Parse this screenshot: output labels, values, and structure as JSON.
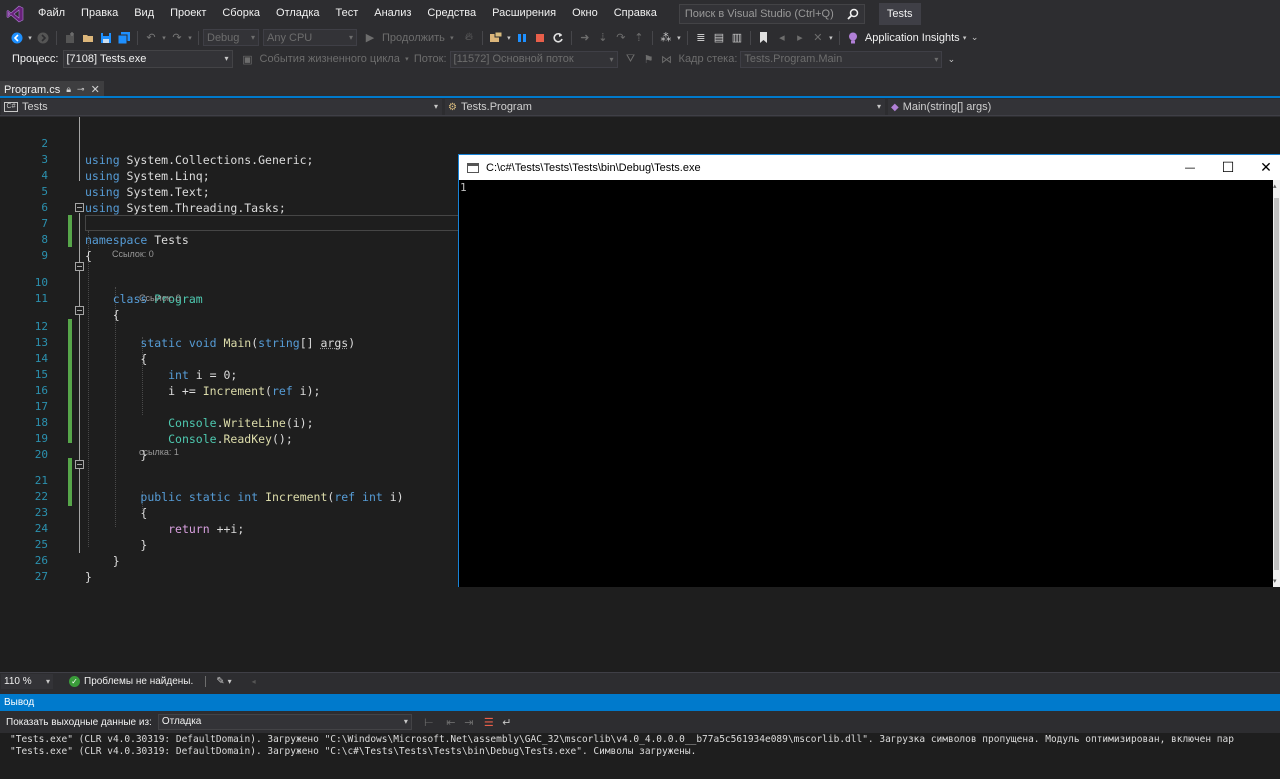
{
  "menu": {
    "items": [
      "Файл",
      "Правка",
      "Вид",
      "Проект",
      "Сборка",
      "Отладка",
      "Тест",
      "Анализ",
      "Средства",
      "Расширения",
      "Окно",
      "Справка"
    ],
    "search_placeholder": "Поиск в Visual Studio (Ctrl+Q)",
    "solution_name": "Tests"
  },
  "toolbar": {
    "config": "Debug",
    "platform": "Any CPU",
    "continue_label": "Продолжить",
    "app_insights": "Application Insights"
  },
  "debug_toolbar": {
    "process_label": "Процесс:",
    "process_value": "[7108] Tests.exe",
    "lifecycle_label": "События жизненного цикла",
    "thread_label": "Поток:",
    "thread_value": "[11572] Основной поток",
    "stack_label": "Кадр стека:",
    "stack_value": "Tests.Program.Main"
  },
  "document": {
    "tab_name": "Program.cs",
    "nav_project": "Tests",
    "nav_class": "Tests.Program",
    "nav_member": "Main(string[] args)"
  },
  "code": {
    "line_numbers": [
      "2",
      "3",
      "4",
      "5",
      "6",
      "7",
      "8",
      "9",
      "10",
      "11",
      "12",
      "13",
      "14",
      "15",
      "16",
      "17",
      "18",
      "19",
      "20",
      "21",
      "22",
      "23",
      "24",
      "25",
      "26",
      "27"
    ],
    "lens_refs_0": "Ссылок: 0",
    "lens_refs_1": "ссылка: 1"
  },
  "console": {
    "title": "C:\\c#\\Tests\\Tests\\Tests\\bin\\Debug\\Tests.exe",
    "output": "1",
    "minimize": "—",
    "maximize": "☐",
    "close": "✕"
  },
  "editor_status": {
    "zoom": "110 %",
    "problems": "Проблемы не найдены."
  },
  "output_panel": {
    "title": "Вывод",
    "show_from_label": "Показать выходные данные из:",
    "source": "Отладка",
    "lines": [
      "\"Tests.exe\" (CLR v4.0.30319: DefaultDomain). Загружено \"C:\\Windows\\Microsoft.Net\\assembly\\GAC_32\\mscorlib\\v4.0_4.0.0.0__b77a5c561934e089\\mscorlib.dll\". Загрузка символов пропущена. Модуль оптимизирован, включен пар",
      "\"Tests.exe\" (CLR v4.0.30319: DefaultDomain). Загружено \"C:\\c#\\Tests\\Tests\\Tests\\bin\\Debug\\Tests.exe\". Символы загружены."
    ]
  },
  "colors": {
    "accent": "#007acc",
    "editor_bg": "#1e1e1e",
    "chrome_bg": "#2d2d30",
    "keyword": "#569cd6",
    "type": "#4ec9b0",
    "method": "#dcdcaa",
    "line_number": "#2b91af"
  }
}
